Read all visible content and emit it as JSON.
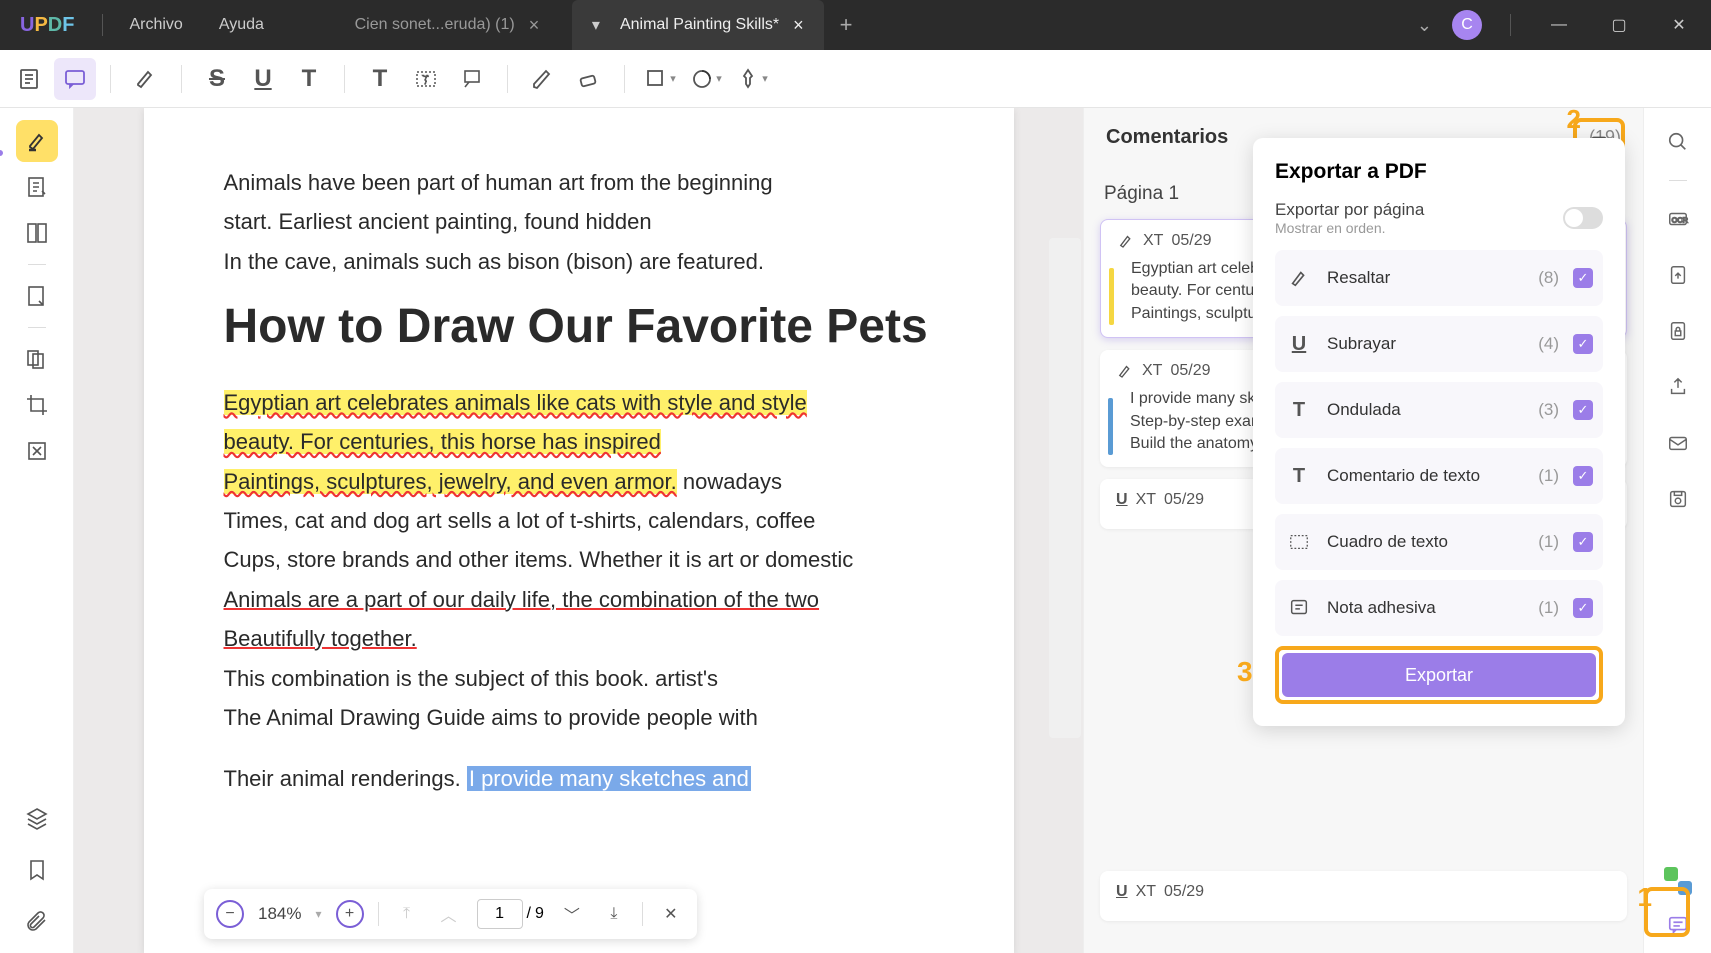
{
  "titlebar": {
    "menu": {
      "archivo": "Archivo",
      "ayuda": "Ayuda"
    },
    "tabs": [
      {
        "title": "Cien sonet...eruda) (1)",
        "active": false
      },
      {
        "title": "Animal Painting Skills*",
        "active": true
      }
    ],
    "avatar": "C"
  },
  "comments": {
    "title": "Comentarios",
    "count": "(19)",
    "page_label": "Página 1",
    "items": [
      {
        "icon": "highlight",
        "author": "XT",
        "date": "05/29",
        "text": "Egyptian art celebrates animals... beauty. For centuries... Paintings, sculpture...",
        "bar": "y"
      },
      {
        "icon": "highlight",
        "author": "XT",
        "date": "05/29",
        "text": "I provide many sketches... Step-by-step exam... Build the anatomy...",
        "bar": "b"
      },
      {
        "icon": "underline",
        "author": "XT",
        "date": "05/29",
        "text": ""
      },
      {
        "icon": "underline",
        "author": "XT",
        "date": "05/29",
        "text": ""
      }
    ]
  },
  "export_popup": {
    "title": "Exportar a PDF",
    "per_page": "Exportar por página",
    "per_page_sub": "Mostrar en orden.",
    "items": [
      {
        "name": "Resaltar",
        "count": "(8)"
      },
      {
        "name": "Subrayar",
        "count": "(4)"
      },
      {
        "name": "Ondulada",
        "count": "(3)"
      },
      {
        "name": "Comentario de texto",
        "count": "(1)"
      },
      {
        "name": "Cuadro de texto",
        "count": "(1)"
      },
      {
        "name": "Nota adhesiva",
        "count": "(1)"
      }
    ],
    "button": "Exportar"
  },
  "document": {
    "p1": "Animals have been part of human art from the beginning",
    "p2": "start. Earliest ancient painting, found hidden",
    "p3": "In the cave, animals such as bison (bison) are featured.",
    "h": "How to Draw Our Favorite Pets",
    "p4": "Egyptian art celebrates animals like cats with style and style",
    "p5": "beauty. For centuries, this horse has inspired",
    "p6": "Paintings, sculptures, jewelry, and even armor.",
    "p6b": " nowadays",
    "p7": "Times, cat and dog art sells a lot of t-shirts, calendars, coffee",
    "p8": "Cups, store brands and other items. Whether it is art or domestic",
    "p9": "Animals are a part of our daily life, the combination of the two",
    "p10": "Beautifully together.",
    "p11": "This combination is the subject of this book. artist's",
    "p12": "The Animal Drawing Guide aims to provide people with",
    "p13a": "Their animal renderings. ",
    "p13b": "I provide many sketches and"
  },
  "nav": {
    "zoom": "184%",
    "current": "1",
    "sep": " / ",
    "total": "9"
  },
  "callouts": {
    "n1": "1",
    "n2": "2",
    "n3": "3"
  }
}
